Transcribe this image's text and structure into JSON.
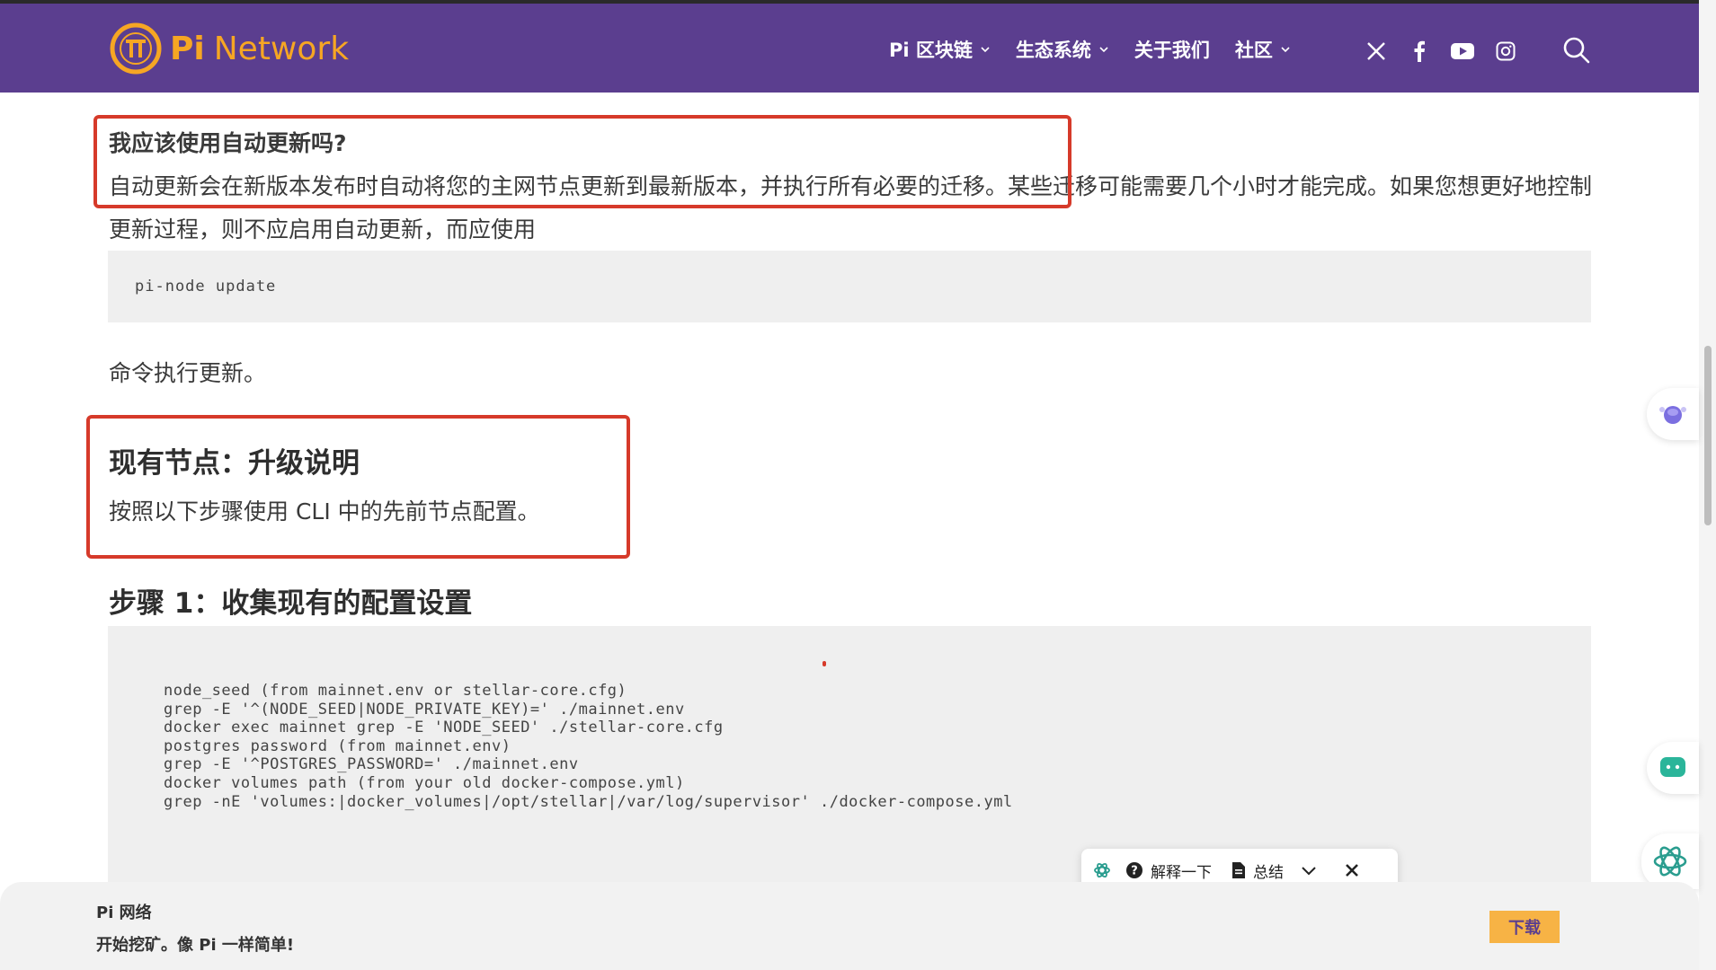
{
  "header": {
    "logo_pi": "Pi",
    "logo_network": "Network",
    "nav": [
      {
        "label": "Pi 区块链",
        "has_dropdown": true
      },
      {
        "label": "生态系统",
        "has_dropdown": true
      },
      {
        "label": "关于我们",
        "has_dropdown": false
      },
      {
        "label": "社区",
        "has_dropdown": true
      }
    ],
    "socials": [
      "x-icon",
      "facebook-icon",
      "youtube-icon",
      "instagram-icon"
    ],
    "brand_color": "#5b3e8f",
    "accent_color": "#f6a623"
  },
  "content": {
    "question_title": "我应该使用自动更新吗?",
    "question_body": "自动更新会在新版本发布时自动将您的主网节点更新到最新版本，并执行所有必要的迁移。某些迁移可能需要几个小时才能完成。如果您想更好地控制更新过程，则不应启用自动更新，而应使用",
    "code_update": "pi-node update",
    "command_text": "命令执行更新。",
    "section_title": "现有节点：升级说明",
    "section_body": "按照以下步骤使用 CLI 中的先前节点配置。",
    "step_title": "步骤 1：收集现有的配置设置",
    "code_lines": [
      "node_seed (from mainnet.env or stellar-core.cfg)",
      "grep -E '^(NODE_SEED|NODE_PRIVATE_KEY)=' ./mainnet.env",
      "docker exec mainnet grep -E 'NODE_SEED' ./stellar-core.cfg",
      "postgres password (from mainnet.env)",
      "grep -E '^POSTGRES_PASSWORD=' ./mainnet.env",
      "docker volumes path (from your old docker-compose.yml)",
      "grep -nE 'volumes:|docker_volumes|/opt/stellar|/var/log/supervisor' ./docker-compose.yml"
    ],
    "highlight_color": "#d63a2a"
  },
  "toolbar": {
    "explain_label": "解释一下",
    "summary_label": "总结"
  },
  "banner": {
    "title": "Pi 网络",
    "subtitle": "开始挖矿。像 Pi 一样简单!",
    "download_label": "下载"
  }
}
